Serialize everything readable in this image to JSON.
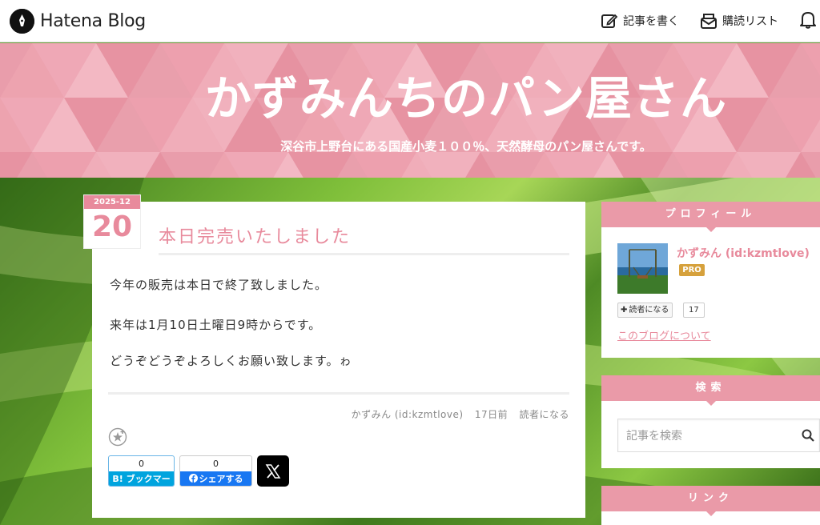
{
  "navbar": {
    "logo_text": "Hatena Blog",
    "write_label": "記事を書く",
    "reading_list_label": "購読リスト",
    "icons": [
      "hatena-pen-icon",
      "edit-icon",
      "reading-list-icon",
      "bell-icon"
    ]
  },
  "banner": {
    "title": "かずみんちのパン屋さん",
    "description": "深谷市上野台にある国産小麦１００％、天然酵母のパン屋さんです。"
  },
  "entry": {
    "date_year_month": "2025-12",
    "date_day": "20",
    "title": "本日完売いたしました",
    "paragraphs": [
      "今年の販売は本日で終了致しました。",
      "来年は1月10日土曜日9時からです。",
      "どうぞどうぞよろしくお願い致します。ゎ"
    ],
    "author": "かずみん (id:kzmtlove)",
    "time_ago": "17日前",
    "subscribe_label": "読者になる"
  },
  "share": {
    "hatena_count": "0",
    "hatena_label": "B! ブックマーク",
    "facebook_count": "0",
    "facebook_label": "シェアする"
  },
  "sidebar": {
    "profile": {
      "heading": "プロフィール",
      "name": "かずみん (id:kzmtlove)",
      "badge": "PRO",
      "reader_button": "読者になる",
      "reader_count": "17",
      "about_link": "このブログについて"
    },
    "search": {
      "heading": "検索",
      "placeholder": "記事を検索"
    },
    "links": {
      "heading": "リンク"
    }
  },
  "colors": {
    "accent": "#e88a9c",
    "banner": "#ea9aa8",
    "pro_badge": "#d6a13c",
    "hatena_blue": "#00a4de",
    "facebook_blue": "#1877f2"
  }
}
